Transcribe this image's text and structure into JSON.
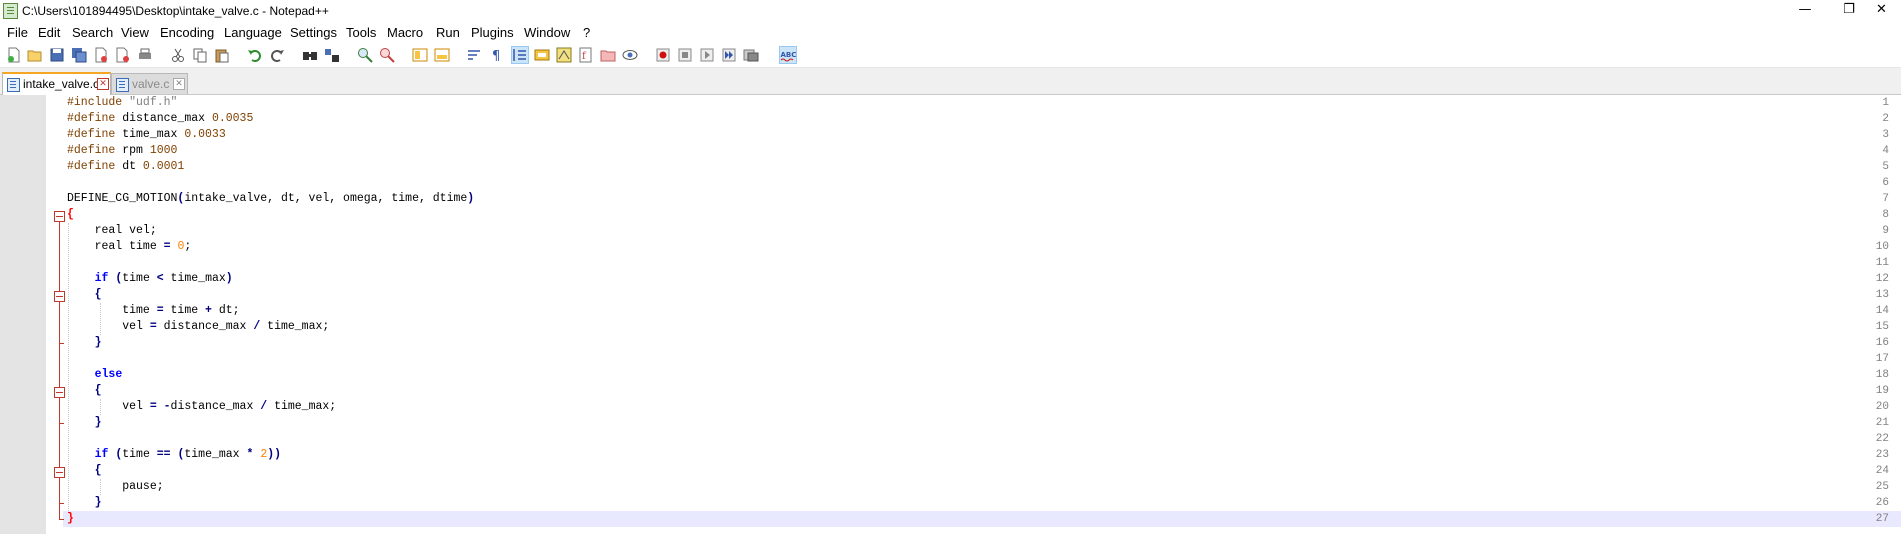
{
  "window": {
    "title": "C:\\Users\\101894495\\Desktop\\intake_valve.c - Notepad++",
    "minimize": "—",
    "restore": "❐",
    "close": "✕"
  },
  "menu": [
    "File",
    "Edit",
    "Search",
    "View",
    "Encoding",
    "Language",
    "Settings",
    "Tools",
    "Macro",
    "Run",
    "Plugins",
    "Window",
    "?"
  ],
  "tabs": [
    {
      "label": "intake_valve.c",
      "active": true
    },
    {
      "label": "valve.c",
      "active": false
    }
  ],
  "toolbar_icons": [
    "new-file-icon",
    "open-file-icon",
    "save-icon",
    "save-all-icon",
    "close-icon",
    "close-all-icon",
    "print-icon",
    "cut-icon",
    "copy-icon",
    "paste-icon",
    "undo-icon",
    "redo-icon",
    "find-icon",
    "replace-icon",
    "zoom-in-icon",
    "zoom-out-icon",
    "sync-vertical-icon",
    "sync-horizontal-icon",
    "word-wrap-icon",
    "show-all-chars-icon",
    "indent-guide-icon",
    "user-defined-language-icon",
    "document-map-icon",
    "function-list-icon",
    "folder-workspace-icon",
    "monitoring-icon",
    "record-macro-icon",
    "stop-record-icon",
    "play-macro-icon",
    "run-macro-multiple-icon",
    "save-macro-icon",
    "spell-check-icon"
  ],
  "editor": {
    "lines": [
      {
        "n": "1",
        "text": "#include \"udf.h\""
      },
      {
        "n": "2",
        "text": "#define distance_max 0.0035"
      },
      {
        "n": "3",
        "text": "#define time_max 0.0033"
      },
      {
        "n": "4",
        "text": "#define rpm 1000"
      },
      {
        "n": "5",
        "text": "#define dt 0.0001"
      },
      {
        "n": "6",
        "text": ""
      },
      {
        "n": "7",
        "text": "DEFINE_CG_MOTION(intake_valve, dt, vel, omega, time, dtime)"
      },
      {
        "n": "8",
        "text": "{"
      },
      {
        "n": "9",
        "text": "    real vel;"
      },
      {
        "n": "10",
        "text": "    real time = 0;"
      },
      {
        "n": "11",
        "text": ""
      },
      {
        "n": "12",
        "text": "    if (time < time_max)"
      },
      {
        "n": "13",
        "text": "    {"
      },
      {
        "n": "14",
        "text": "        time = time + dt;"
      },
      {
        "n": "15",
        "text": "        vel = distance_max / time_max;"
      },
      {
        "n": "16",
        "text": "    }"
      },
      {
        "n": "17",
        "text": ""
      },
      {
        "n": "18",
        "text": "    else"
      },
      {
        "n": "19",
        "text": "    {"
      },
      {
        "n": "20",
        "text": "        vel = -distance_max / time_max;"
      },
      {
        "n": "21",
        "text": "    }"
      },
      {
        "n": "22",
        "text": ""
      },
      {
        "n": "23",
        "text": "    if (time == (time_max * 2))"
      },
      {
        "n": "24",
        "text": "    {"
      },
      {
        "n": "25",
        "text": "        pause;"
      },
      {
        "n": "26",
        "text": "    }"
      },
      {
        "n": "27",
        "text": "}"
      }
    ],
    "current_line": 27
  }
}
